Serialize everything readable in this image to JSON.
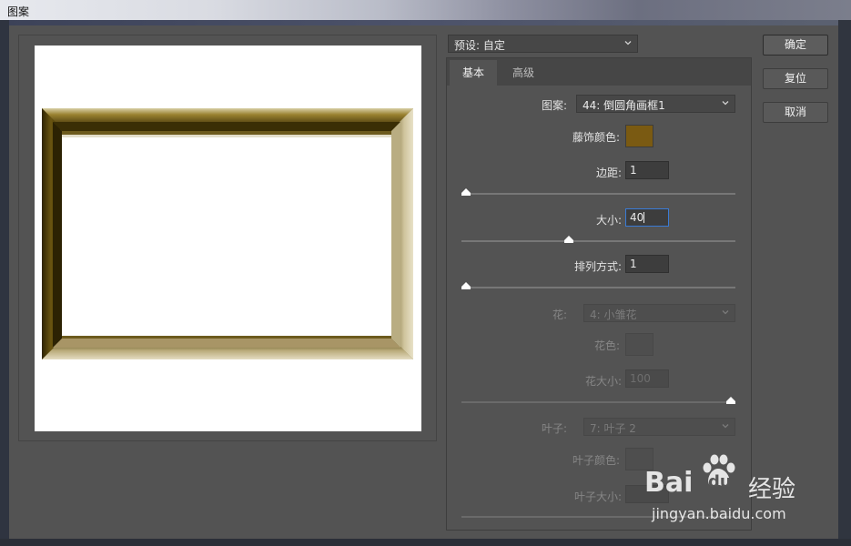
{
  "window": {
    "title": "图案"
  },
  "preset": {
    "label": "预设: 自定"
  },
  "tabs": [
    {
      "label": "基本",
      "active": true
    },
    {
      "label": "高级",
      "active": false
    }
  ],
  "basic": {
    "pattern": {
      "label": "图案:",
      "value": "44: 倒圆角画框1"
    },
    "decor_color": {
      "label": "藤饰颜色:",
      "color": "#7a5a12"
    },
    "margin": {
      "label": "边距:",
      "value": "1",
      "slider": 0.0
    },
    "size": {
      "label": "大小:",
      "value": "40",
      "slider": 0.39
    },
    "arrangement": {
      "label": "排列方式:",
      "value": "1",
      "slider": 0.0
    },
    "flower": {
      "label": "花:",
      "value": "4: 小雏花"
    },
    "flower_color": {
      "label": "花色:"
    },
    "flower_size": {
      "label": "花大小:",
      "value": "100",
      "slider": 1.0
    },
    "leaf": {
      "label": "叶子:",
      "value": "7: 叶子 2"
    },
    "leaf_color": {
      "label": "叶子颜色:"
    },
    "leaf_size": {
      "label": "叶子大小:"
    }
  },
  "buttons": {
    "ok": "确定",
    "reset": "复位",
    "cancel": "取消"
  },
  "watermark": {
    "brand": "Bai",
    "brand2": "du",
    "suffix": "经验",
    "url": "jingyan.baidu.com"
  },
  "colors": {
    "frame_gold": "#a08a4a",
    "frame_dark": "#4a3a08",
    "accent_focus": "#3a7bd5"
  }
}
